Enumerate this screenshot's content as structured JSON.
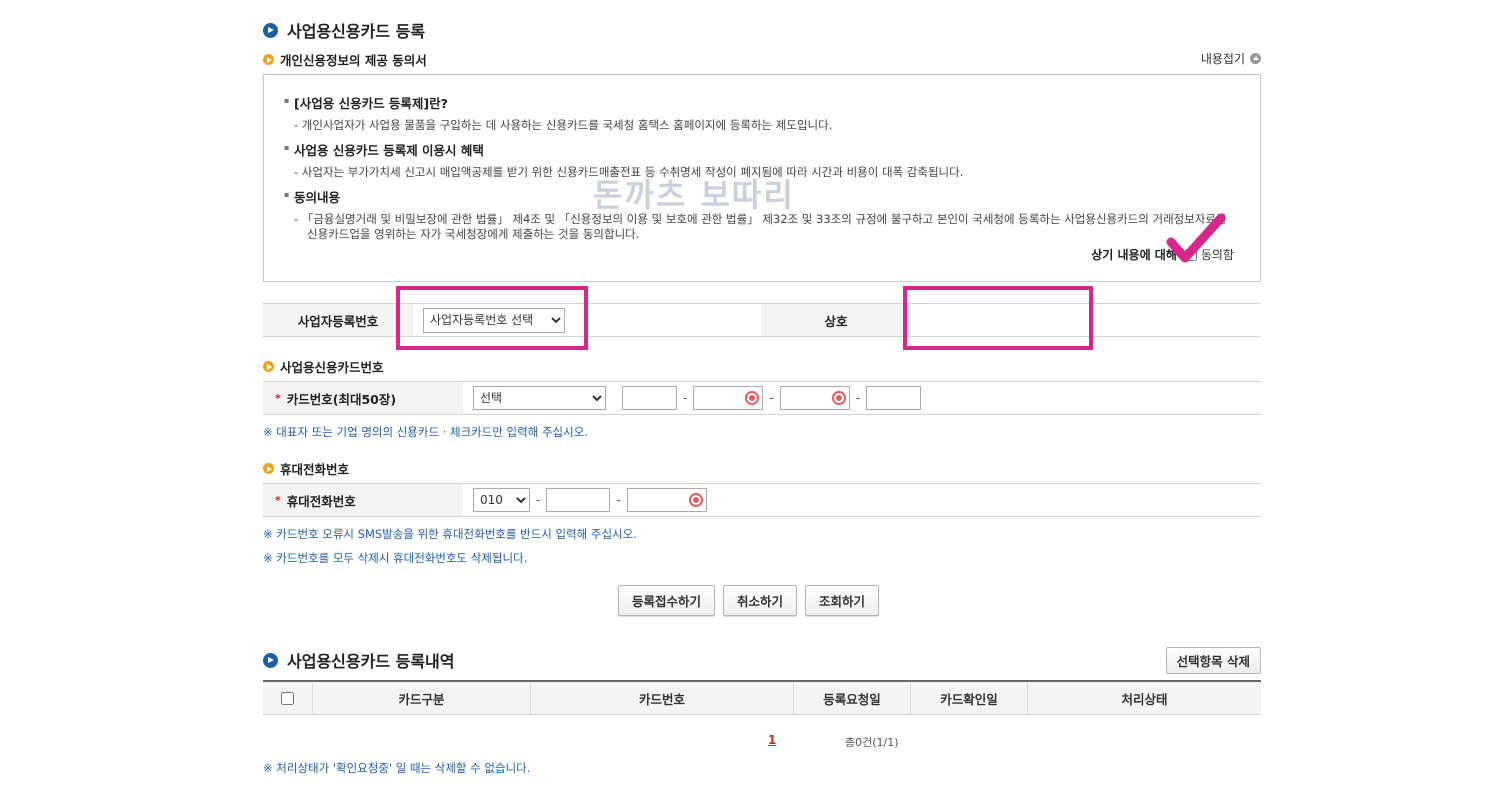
{
  "section1": {
    "title": "사업용신용카드 등록"
  },
  "consent": {
    "heading": "개인신용정보의 제공 동의서",
    "fold_label": "내용접기",
    "items": [
      {
        "title": "[사업용 신용카드 등록제]란?",
        "desc": "- 개인사업자가 사업용 물품을 구입하는 데 사용하는 신용카드를 국세청 홈택스 홈페이지에 등록하는 제도입니다."
      },
      {
        "title": "사업용 신용카드 등록제 이용시 혜택",
        "desc": "- 사업자는 부가가치세 신고시 매입액공제를 받기 위한 신용카드매출전표 등 수취명세 작성이 폐지됨에 따라 시간과 비용이 대폭 감축됩니다."
      },
      {
        "title": "동의내용",
        "desc": "- 「금융실명거래 및 비밀보장에 관한 법률」 제4조 및 「신용정보의 이용 및 보호에 관한 법률」 제32조 및 33조의 규정에 불구하고 본인이 국세청에 등록하는 사업용신용카드의 거래정보자료를 신용카드업을 영위하는 자가 국세청장에게 제출하는 것을 동의합니다."
      }
    ],
    "agree_prefix": "상기 내용에 대해",
    "agree_label": "동의함"
  },
  "watermark": "돈까츠 보따리",
  "biz": {
    "reg_label": "사업자등록번호",
    "reg_select": "사업자등록번호 선택",
    "name_label": "상호",
    "name_value": ""
  },
  "card_section": {
    "heading": "사업용신용카드번호",
    "label": "카드번호(최대50장)",
    "select": "선택",
    "note": "※ 대표자 또는 기업 명의의 신용카드 · 체크카드만 입력해 주십시오."
  },
  "phone_section": {
    "heading": "휴대전화번호",
    "label": "휴대전화번호",
    "prefix": "010",
    "note1": "※ 카드번호 오류시 SMS발송을 위한 휴대전화번호를 반드시 입력해 주십시오.",
    "note2": "※ 카드번호를 모두 삭제시 휴대전화번호도 삭제됩니다."
  },
  "buttons": {
    "register": "등록접수하기",
    "cancel": "취소하기",
    "inquiry": "조회하기"
  },
  "section2": {
    "title": "사업용신용카드 등록내역",
    "delete_btn": "선택항목 삭제",
    "columns": [
      "카드구분",
      "카드번호",
      "등록요청일",
      "카드확인일",
      "처리상태"
    ],
    "page": "1",
    "total": "총0건(1/1)",
    "note": "※ 처리상태가 '확인요청중' 일 때는 삭제할 수 없습니다."
  },
  "colors": {
    "highlight": "#d6288c",
    "note_blue": "#1f5ea8",
    "title_dot": "#1a5fa0",
    "orange_dot": "#f0a020"
  }
}
